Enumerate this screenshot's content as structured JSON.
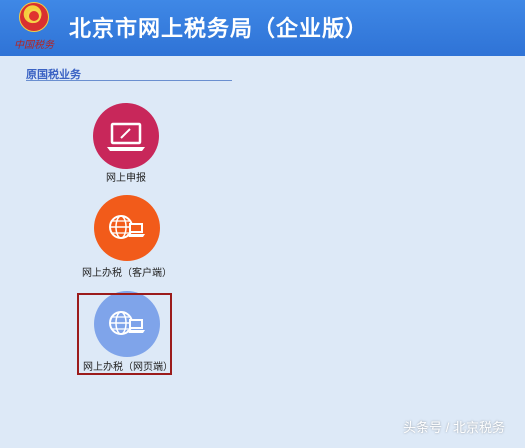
{
  "header": {
    "title": "北京市网上税务局（企业版）",
    "emblem_script": "中国税务",
    "background": "#3480e0"
  },
  "section": {
    "title": "原国税业务"
  },
  "items": [
    {
      "label": "网上申报",
      "icon": "laptop-icon",
      "color": "#c8275a"
    },
    {
      "label": "网上办税（客户端）",
      "icon": "globe-computer-icon",
      "color": "#f25b1a"
    },
    {
      "label": "网上办税（网页端）",
      "icon": "globe-computer-icon",
      "color": "#7fa4ea"
    }
  ],
  "watermark": "头条号 / 北京税务"
}
